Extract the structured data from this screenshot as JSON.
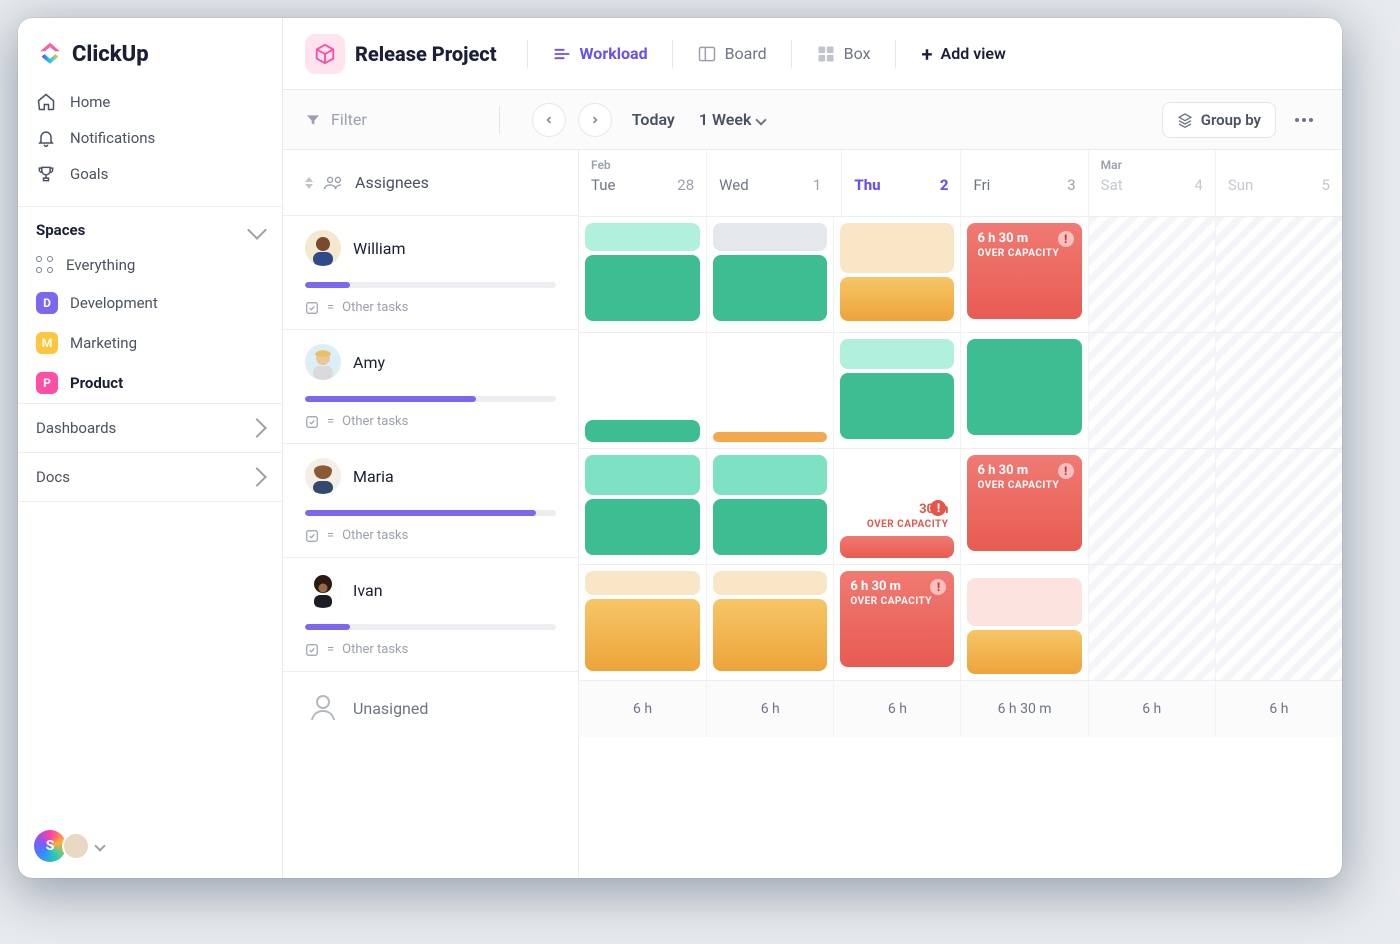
{
  "brand": "ClickUp",
  "sidebar": {
    "nav": [
      {
        "label": "Home"
      },
      {
        "label": "Notifications"
      },
      {
        "label": "Goals"
      }
    ],
    "spaces_header": "Spaces",
    "everything": "Everything",
    "spaces": [
      {
        "letter": "D",
        "label": "Development",
        "color": "#7b68ee"
      },
      {
        "letter": "M",
        "label": "Marketing",
        "color": "#ffc53d"
      },
      {
        "letter": "P",
        "label": "Product",
        "color": "#fd4fa3",
        "bold": true
      }
    ],
    "sections": [
      {
        "label": "Dashboards"
      },
      {
        "label": "Docs"
      }
    ],
    "footer_initial": "S"
  },
  "topbar": {
    "project": "Release Project",
    "views": [
      {
        "label": "Workload",
        "active": true
      },
      {
        "label": "Board"
      },
      {
        "label": "Box"
      }
    ],
    "add_view": "Add view"
  },
  "toolbar": {
    "filter": "Filter",
    "today": "Today",
    "range": "1 Week",
    "group_by": "Group by"
  },
  "grid": {
    "assignee_header": "Assignees",
    "months": {
      "m1": "Feb",
      "m2": "Mar"
    },
    "days": [
      {
        "name": "Tue",
        "num": "28"
      },
      {
        "name": "Wed",
        "num": "1"
      },
      {
        "name": "Thu",
        "num": "2",
        "today": true
      },
      {
        "name": "Fri",
        "num": "3"
      },
      {
        "name": "Sat",
        "num": "4",
        "weekend": true
      },
      {
        "name": "Sun",
        "num": "5",
        "weekend": true
      }
    ],
    "other_tasks": "Other tasks",
    "assignees": [
      {
        "name": "William",
        "progress": 18
      },
      {
        "name": "Amy",
        "progress": 68
      },
      {
        "name": "Maria",
        "progress": 92
      },
      {
        "name": "Ivan",
        "progress": 18
      }
    ],
    "unassigned": "Unasigned",
    "overcap": {
      "t1": "6 h 30 m",
      "t2": "30 m",
      "sub": "OVER CAPACITY"
    },
    "footer_hours": [
      "6 h",
      "6 h",
      "6 h",
      "6 h 30 m",
      "6 h",
      "6 h"
    ]
  }
}
